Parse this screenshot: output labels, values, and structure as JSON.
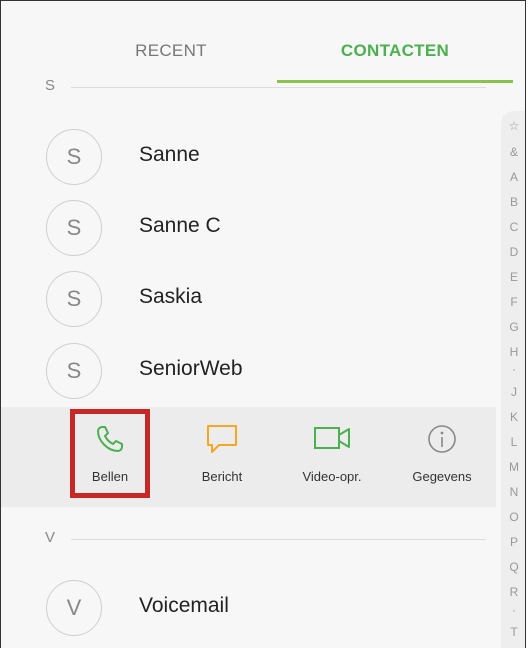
{
  "tabs": {
    "recent": "RECENT",
    "contacten": "CONTACTEN"
  },
  "sections": [
    {
      "letter": "S"
    },
    {
      "letter": "V"
    }
  ],
  "contacts": [
    {
      "initial": "S",
      "name": "Sanne"
    },
    {
      "initial": "S",
      "name": "Sanne C"
    },
    {
      "initial": "S",
      "name": "Saskia"
    },
    {
      "initial": "S",
      "name": "SeniorWeb"
    },
    {
      "initial": "V",
      "name": "Voicemail"
    }
  ],
  "actions": [
    {
      "label": "Bellen",
      "icon": "phone-icon",
      "color": "#4caf50"
    },
    {
      "label": "Bericht",
      "icon": "message-icon",
      "color": "#f5a623"
    },
    {
      "label": "Video-opr.",
      "icon": "video-call-icon",
      "color": "#4caf50"
    },
    {
      "label": "Gegevens",
      "icon": "info-icon",
      "color": "#888888"
    }
  ],
  "index_letters": [
    "☆",
    "&",
    "A",
    "B",
    "C",
    "D",
    "E",
    "F",
    "G",
    "H",
    "·",
    "J",
    "K",
    "L",
    "M",
    "N",
    "O",
    "P",
    "Q",
    "R",
    "·",
    "T"
  ],
  "colors": {
    "accent": "#4caf50",
    "highlight": "#c62828"
  }
}
